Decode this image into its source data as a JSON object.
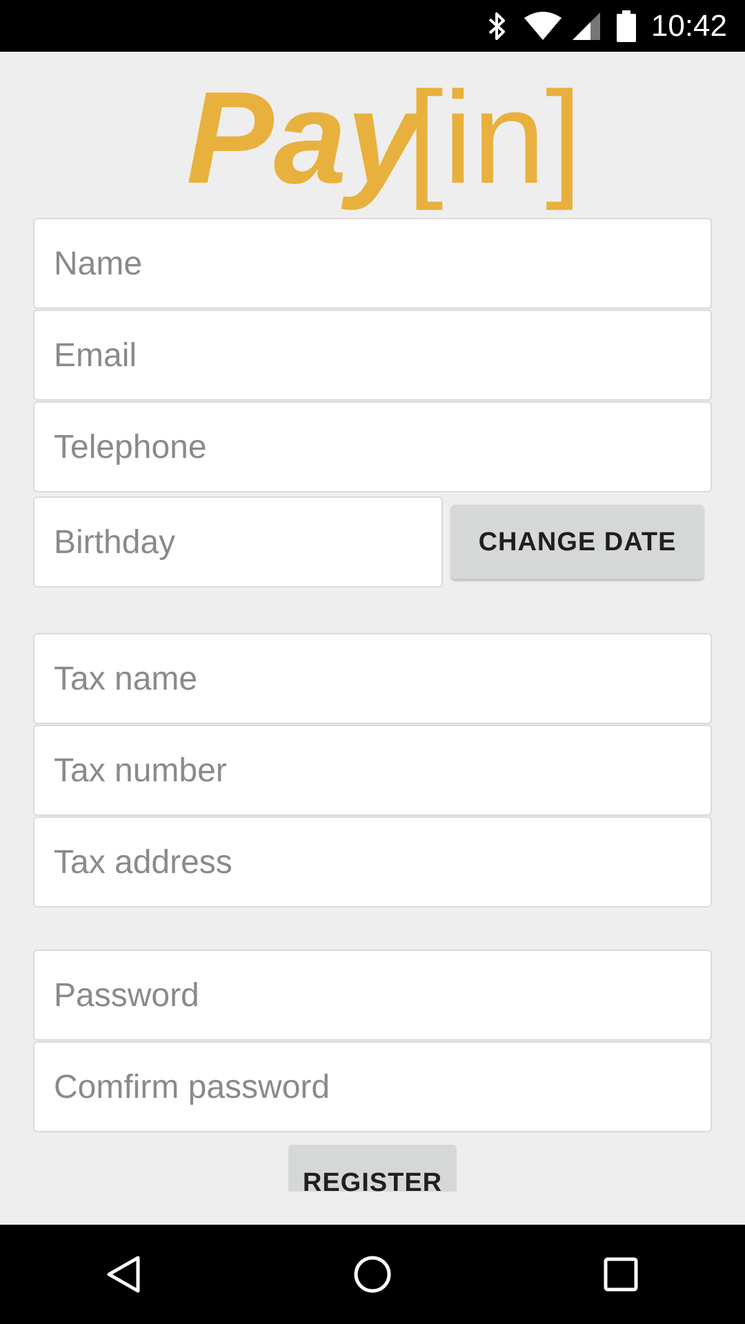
{
  "status_bar": {
    "time": "10:42",
    "icons": [
      "bluetooth-icon",
      "wifi-icon",
      "cell-signal-icon",
      "battery-icon"
    ]
  },
  "logo": {
    "text_pay": "Pay",
    "text_in": "[in]",
    "color": "#e8b13d"
  },
  "form": {
    "name_placeholder": "Name",
    "email_placeholder": "Email",
    "telephone_placeholder": "Telephone",
    "birthday_placeholder": "Birthday",
    "change_date_label": "CHANGE DATE",
    "tax_name_placeholder": "Tax name",
    "tax_number_placeholder": "Tax number",
    "tax_address_placeholder": "Tax address",
    "password_placeholder": "Password",
    "confirm_password_placeholder": "Comfirm password",
    "register_label": "REGISTER"
  },
  "nav_bar": {
    "icons": [
      "back-icon",
      "home-icon",
      "recents-icon"
    ]
  },
  "colors": {
    "background": "#eeeeee",
    "accent": "#e8b13d",
    "button": "#d6d7d7"
  }
}
